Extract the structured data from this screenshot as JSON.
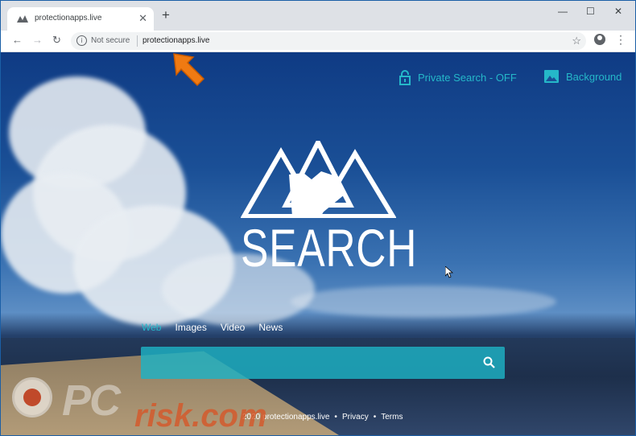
{
  "browser": {
    "tab_title": "protectionapps.live",
    "tab_close": "✕",
    "new_tab": "+",
    "window_controls": {
      "minimize": "—",
      "maximize": "☐",
      "close": "✕"
    },
    "nav": {
      "back": "←",
      "forward": "→",
      "reload": "↻"
    },
    "security_label": "Not secure",
    "url": "protectionapps.live",
    "star": "☆",
    "menu": "⋮"
  },
  "page": {
    "private_search": "Private Search - OFF",
    "background": "Background",
    "logo_text": "SEARCH",
    "categories": [
      {
        "label": "Web",
        "active": true
      },
      {
        "label": "Images",
        "active": false
      },
      {
        "label": "Video",
        "active": false
      },
      {
        "label": "News",
        "active": false
      }
    ],
    "search": {
      "placeholder": ""
    },
    "footer": {
      "copyright": "2020 protectionapps.live",
      "sep1": "•",
      "privacy": "Privacy",
      "sep2": "•",
      "terms": "Terms"
    },
    "accent_color": "#25b8c9"
  },
  "watermark": {
    "text1": "PC",
    "text2": "risk.com"
  }
}
